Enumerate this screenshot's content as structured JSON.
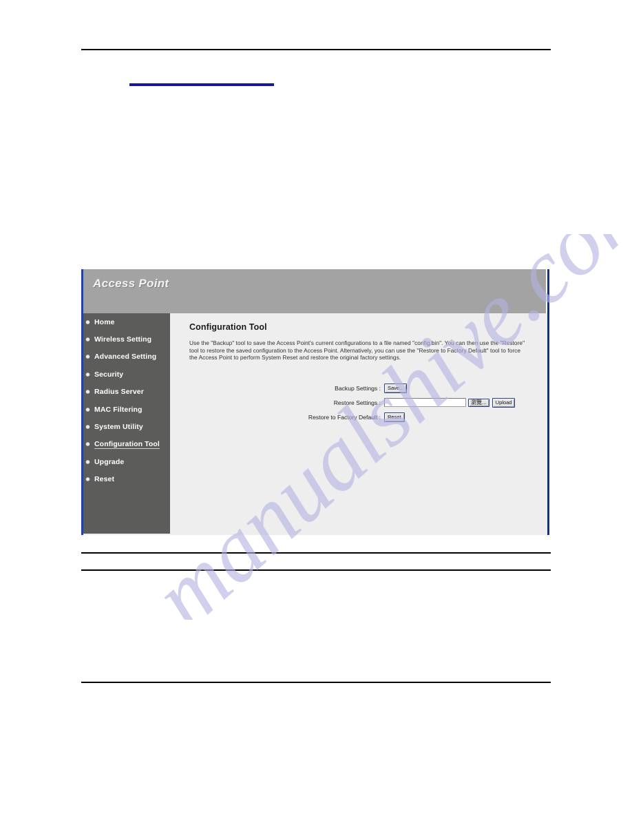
{
  "page": {
    "blue_underline_present": true,
    "watermark_text": "manualshive.com",
    "watermark_color": "#b3b3e0",
    "rule_color": "#000000",
    "accent_blue": "#1515a8"
  },
  "panel": {
    "header": {
      "title": "Access Point",
      "background": "#a3a3a3",
      "title_color": "#f2f2f2"
    },
    "border_color": "#2040b8",
    "sidebar": {
      "background": "#5c5c5a",
      "bullet_color": "#e9e9f2",
      "items": [
        {
          "label": "Home",
          "active": false
        },
        {
          "label": "Wireless Setting",
          "active": false
        },
        {
          "label": "Advanced Setting",
          "active": false
        },
        {
          "label": "Security",
          "active": false
        },
        {
          "label": "Radius Server",
          "active": false
        },
        {
          "label": "MAC Filtering",
          "active": false
        },
        {
          "label": "System Utility",
          "active": false
        },
        {
          "label": "Configuration Tool",
          "active": true
        },
        {
          "label": "Upgrade",
          "active": false
        },
        {
          "label": "Reset",
          "active": false
        }
      ]
    },
    "content": {
      "background": "#eeeeee",
      "title": "Configuration Tool",
      "description": "Use the \"Backup\" tool to save the Access Point's current configurations to a file named \"config.bin\". You can then use the \"Restore\" tool to restore the saved configuration to the Access Point. Alternatively, you can use the \"Restore to Factory Default\" tool to force the Access Point to perform System Reset and restore the original factory settings.",
      "form": {
        "backup": {
          "label": "Backup Settings :",
          "button": "Save..."
        },
        "restore": {
          "label": "Restore Settings :",
          "file_value": "",
          "file_placeholder": "",
          "browse_button": "瀏覽...",
          "upload_button": "Upload"
        },
        "factory": {
          "label": "Restore to Factory Default :",
          "button": "Reset"
        }
      }
    }
  }
}
